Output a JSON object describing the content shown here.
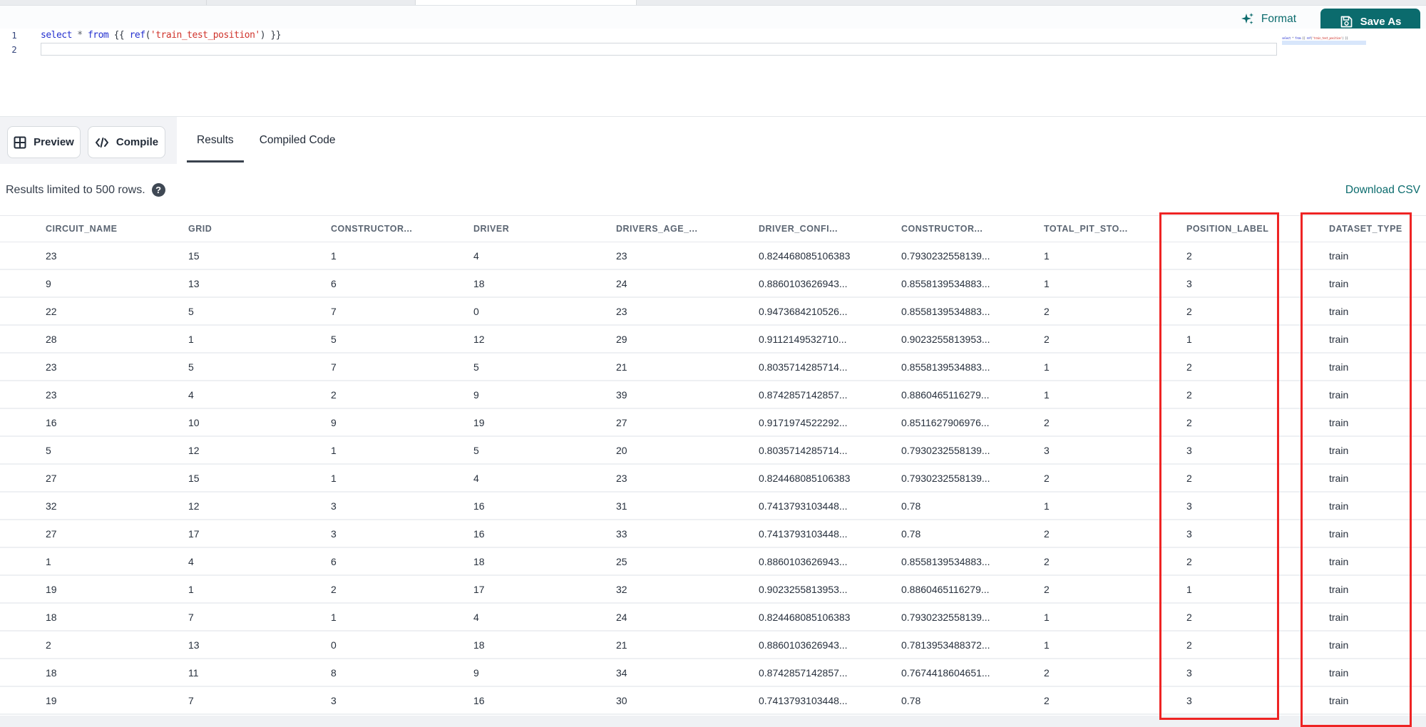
{
  "colors": {
    "accent_teal": "#0b6b6d",
    "highlight_red": "#ee2424",
    "keyword_blue": "#2430cf",
    "string_red": "#d0342c",
    "tab_underline": "#39424d"
  },
  "toolbar": {
    "format_label": "Format",
    "save_as_label": "Save As"
  },
  "editor": {
    "lines": [
      {
        "number": "1",
        "active_box": false,
        "tokens": [
          [
            "select",
            "kw"
          ],
          [
            " ",
            "pl"
          ],
          [
            "*",
            "op"
          ],
          [
            " ",
            "pl"
          ],
          [
            "from",
            "kw"
          ],
          [
            " {{ ",
            "pl"
          ],
          [
            "ref",
            "fn"
          ],
          [
            "(",
            "pl"
          ],
          [
            "'train_test_position'",
            "str"
          ],
          [
            ")",
            "pl"
          ],
          [
            " }}",
            "pl"
          ]
        ]
      },
      {
        "number": "2",
        "active_box": true,
        "tokens": []
      }
    ]
  },
  "actions": {
    "preview_label": "Preview",
    "compile_label": "Compile"
  },
  "tabs": [
    {
      "label": "Results",
      "active": true
    },
    {
      "label": "Compiled Code",
      "active": false
    }
  ],
  "results": {
    "limit_note": "Results limited to 500 rows.",
    "help_glyph": "?",
    "download_label": "Download CSV"
  },
  "table": {
    "columns": [
      "CIRCUIT_NAME",
      "GRID",
      "CONSTRUCTOR...",
      "DRIVER",
      "DRIVERS_AGE_...",
      "DRIVER_CONFI...",
      "CONSTRUCTOR...",
      "TOTAL_PIT_STO...",
      "POSITION_LABEL",
      "DATASET_TYPE"
    ],
    "highlighted_columns": [
      "POSITION_LABEL",
      "DATASET_TYPE"
    ],
    "rows": [
      [
        "23",
        "15",
        "1",
        "4",
        "23",
        "0.824468085106383",
        "0.7930232558139...",
        "1",
        "2",
        "train"
      ],
      [
        "9",
        "13",
        "6",
        "18",
        "24",
        "0.8860103626943...",
        "0.8558139534883...",
        "1",
        "3",
        "train"
      ],
      [
        "22",
        "5",
        "7",
        "0",
        "23",
        "0.9473684210526...",
        "0.8558139534883...",
        "2",
        "2",
        "train"
      ],
      [
        "28",
        "1",
        "5",
        "12",
        "29",
        "0.9112149532710...",
        "0.9023255813953...",
        "2",
        "1",
        "train"
      ],
      [
        "23",
        "5",
        "7",
        "5",
        "21",
        "0.8035714285714...",
        "0.8558139534883...",
        "1",
        "2",
        "train"
      ],
      [
        "23",
        "4",
        "2",
        "9",
        "39",
        "0.8742857142857...",
        "0.8860465116279...",
        "1",
        "2",
        "train"
      ],
      [
        "16",
        "10",
        "9",
        "19",
        "27",
        "0.9171974522292...",
        "0.8511627906976...",
        "2",
        "2",
        "train"
      ],
      [
        "5",
        "12",
        "1",
        "5",
        "20",
        "0.8035714285714...",
        "0.7930232558139...",
        "3",
        "3",
        "train"
      ],
      [
        "27",
        "15",
        "1",
        "4",
        "23",
        "0.824468085106383",
        "0.7930232558139...",
        "2",
        "2",
        "train"
      ],
      [
        "32",
        "12",
        "3",
        "16",
        "31",
        "0.7413793103448...",
        "0.78",
        "1",
        "3",
        "train"
      ],
      [
        "27",
        "17",
        "3",
        "16",
        "33",
        "0.7413793103448...",
        "0.78",
        "2",
        "3",
        "train"
      ],
      [
        "1",
        "4",
        "6",
        "18",
        "25",
        "0.8860103626943...",
        "0.8558139534883...",
        "2",
        "2",
        "train"
      ],
      [
        "19",
        "1",
        "2",
        "17",
        "32",
        "0.9023255813953...",
        "0.8860465116279...",
        "2",
        "1",
        "train"
      ],
      [
        "18",
        "7",
        "1",
        "4",
        "24",
        "0.824468085106383",
        "0.7930232558139...",
        "1",
        "2",
        "train"
      ],
      [
        "2",
        "13",
        "0",
        "18",
        "21",
        "0.8860103626943...",
        "0.7813953488372...",
        "1",
        "2",
        "train"
      ],
      [
        "18",
        "11",
        "8",
        "9",
        "34",
        "0.8742857142857...",
        "0.7674418604651...",
        "2",
        "3",
        "train"
      ],
      [
        "19",
        "7",
        "3",
        "16",
        "30",
        "0.7413793103448...",
        "0.78",
        "2",
        "3",
        "train"
      ]
    ]
  }
}
